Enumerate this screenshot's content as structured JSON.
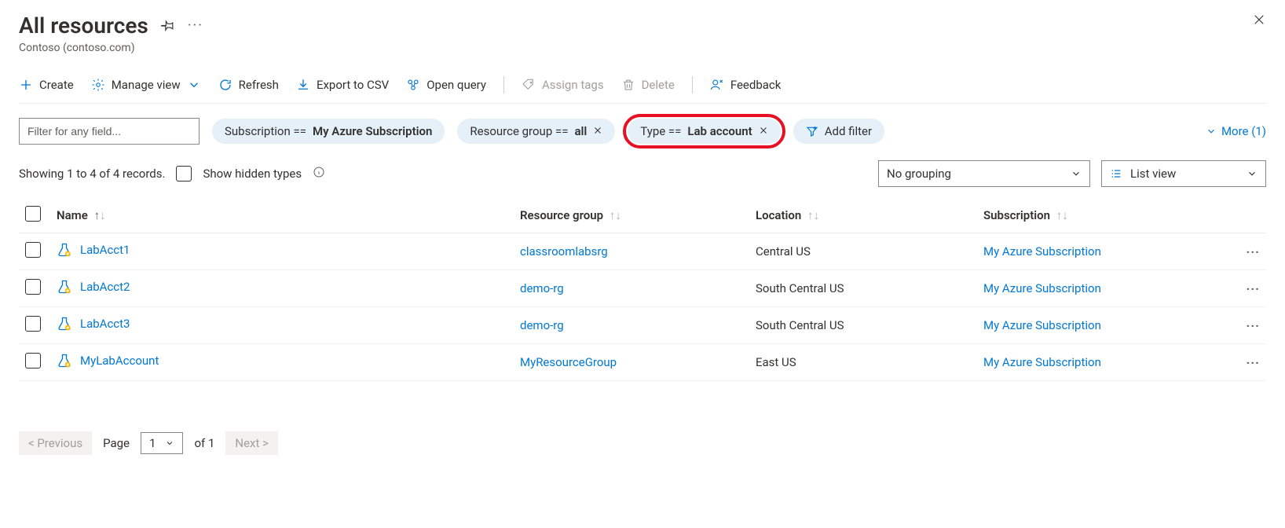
{
  "header": {
    "title": "All resources",
    "subtitle": "Contoso (contoso.com)"
  },
  "toolbar": {
    "create": "Create",
    "manage_view": "Manage view",
    "refresh": "Refresh",
    "export_csv": "Export to CSV",
    "open_query": "Open query",
    "assign_tags": "Assign tags",
    "delete": "Delete",
    "feedback": "Feedback"
  },
  "filters": {
    "placeholder": "Filter for any field...",
    "pills": [
      {
        "label": "Subscription == ",
        "value": "My Azure Subscription",
        "closable": false,
        "highlight": false
      },
      {
        "label": "Resource group == ",
        "value": "all",
        "closable": true,
        "highlight": false
      },
      {
        "label": "Type == ",
        "value": "Lab account",
        "closable": true,
        "highlight": true
      }
    ],
    "add_filter": "Add filter",
    "more": "More (1)"
  },
  "status": {
    "summary": "Showing 1 to 4 of 4 records.",
    "show_hidden": "Show hidden types",
    "grouping": "No grouping",
    "view_mode": "List view"
  },
  "columns": {
    "name": "Name",
    "rg": "Resource group",
    "location": "Location",
    "subscription": "Subscription"
  },
  "rows": [
    {
      "name": "LabAcct1",
      "rg": "classroomlabsrg",
      "location": "Central US",
      "subscription": "My Azure Subscription"
    },
    {
      "name": "LabAcct2",
      "rg": "demo-rg",
      "location": "South Central US",
      "subscription": "My Azure Subscription"
    },
    {
      "name": "LabAcct3",
      "rg": "demo-rg",
      "location": "South Central US",
      "subscription": "My Azure Subscription"
    },
    {
      "name": "MyLabAccount",
      "rg": "MyResourceGroup",
      "location": "East US",
      "subscription": "My Azure Subscription"
    }
  ],
  "pager": {
    "previous": "< Previous",
    "page_label": "Page",
    "page_value": "1",
    "of_label": "of 1",
    "next": "Next >"
  }
}
